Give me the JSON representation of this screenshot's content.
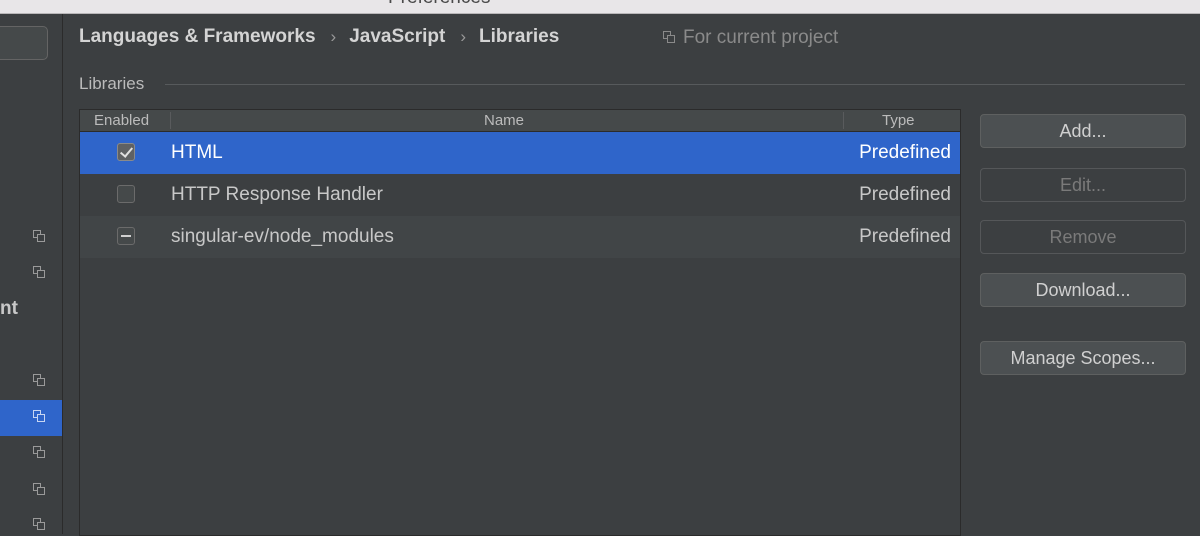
{
  "window": {
    "title": "Preferences"
  },
  "sidebar": {
    "partial_label": "nt",
    "icon_name": "project-scope-icon"
  },
  "breadcrumb": [
    "Languages & Frameworks",
    "JavaScript",
    "Libraries"
  ],
  "scope_label": "For current project",
  "section_title": "Libraries",
  "table": {
    "columns": [
      "Enabled",
      "Name",
      "Type"
    ],
    "rows": [
      {
        "enabled": "checked",
        "name": "HTML",
        "type": "Predefined",
        "selected": true
      },
      {
        "enabled": "unchecked",
        "name": "HTTP Response Handler",
        "type": "Predefined",
        "selected": false
      },
      {
        "enabled": "partial",
        "name": "singular-ev/node_modules",
        "type": "Predefined",
        "selected": false
      }
    ]
  },
  "buttons": {
    "add": "Add...",
    "edit": "Edit...",
    "remove": "Remove",
    "download": "Download...",
    "manage_scopes": "Manage Scopes..."
  },
  "colors": {
    "background": "#3c3f41",
    "selection": "#2f65ca",
    "text": "#bbbbbb"
  }
}
